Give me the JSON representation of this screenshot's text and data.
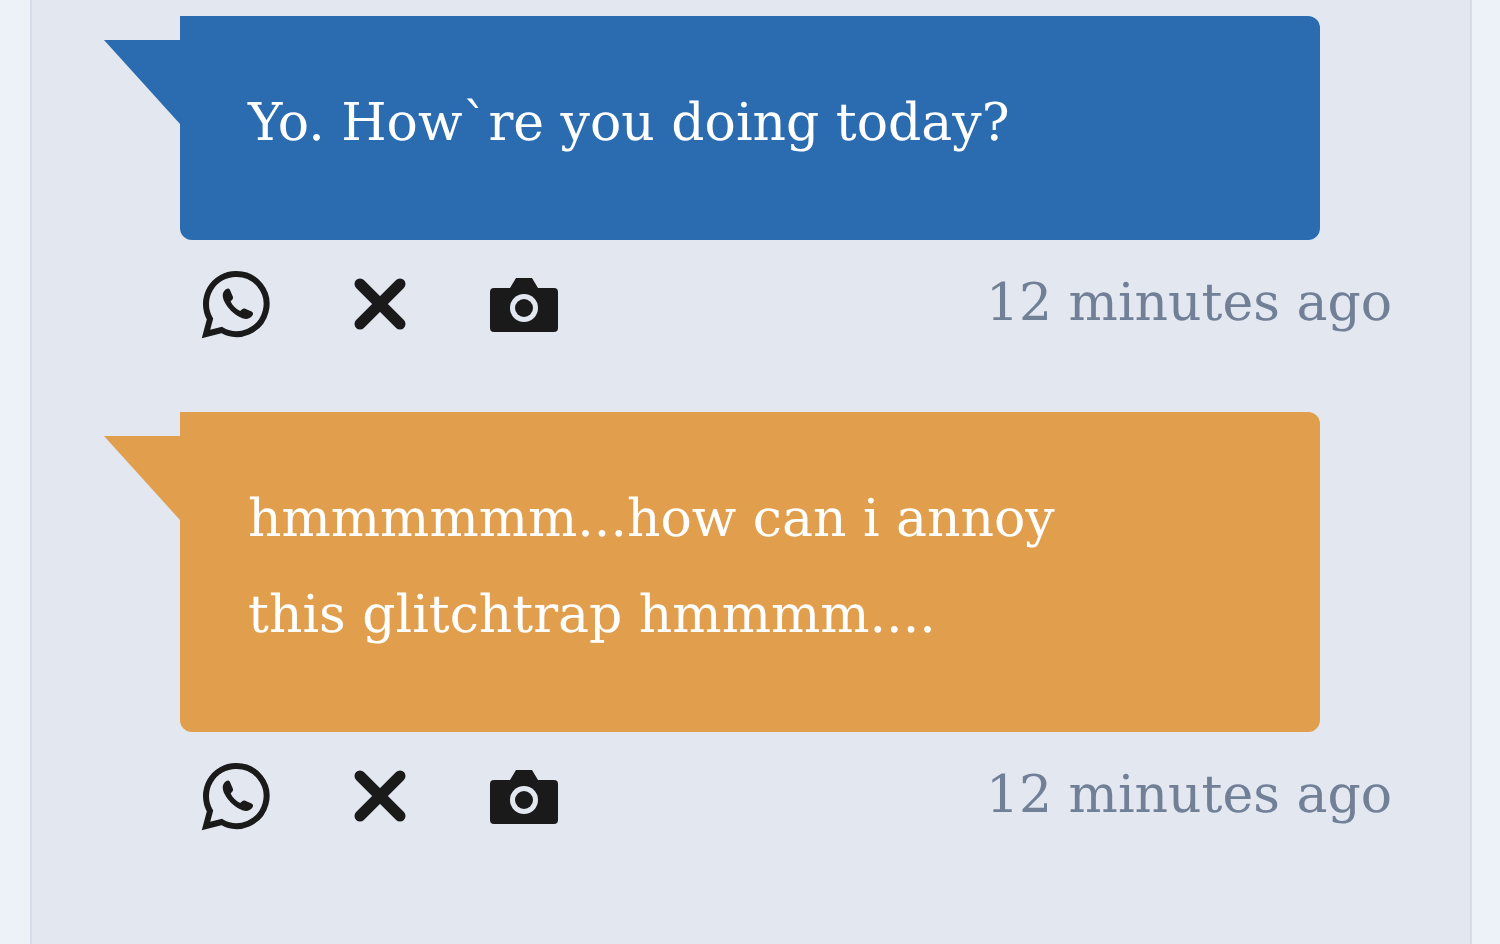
{
  "messages": [
    {
      "text": "Yo. How`re you doing today?",
      "color": "#2b6cb0",
      "time": "12 minutes ago"
    },
    {
      "text": "hmmmmmm...how can i annoy this glitchtrap hmmmm....",
      "color": "#e19e4c",
      "time": "12 minutes ago"
    }
  ]
}
